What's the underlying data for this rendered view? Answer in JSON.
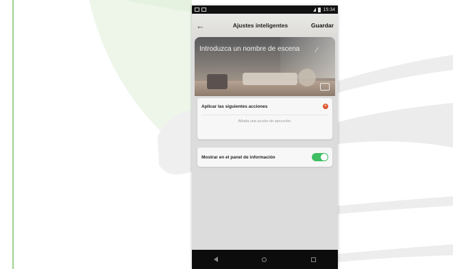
{
  "status_bar": {
    "time": "15:34"
  },
  "toolbar": {
    "back_icon": "back-arrow-icon",
    "title": "Ajustes inteligentes",
    "save_label": "Guardar"
  },
  "scene": {
    "name_placeholder": "Introduzca un nombre de escena",
    "edit_icon": "pencil-icon",
    "image_icon": "image-icon"
  },
  "actions": {
    "label": "Aplicar las siguientes acciones",
    "add_icon": "add-circle-icon",
    "hint": "Añada una acción de ejecución."
  },
  "info_panel": {
    "label": "Mostrar en el panel de información",
    "enabled": true,
    "toggle_color": "#3fbf62"
  },
  "nav_bar": {
    "back_icon": "nav-back-icon",
    "home_icon": "nav-home-icon",
    "recents_icon": "nav-recents-icon"
  },
  "colors": {
    "accent": "#e0582e",
    "toggle_on": "#3fbf62"
  }
}
